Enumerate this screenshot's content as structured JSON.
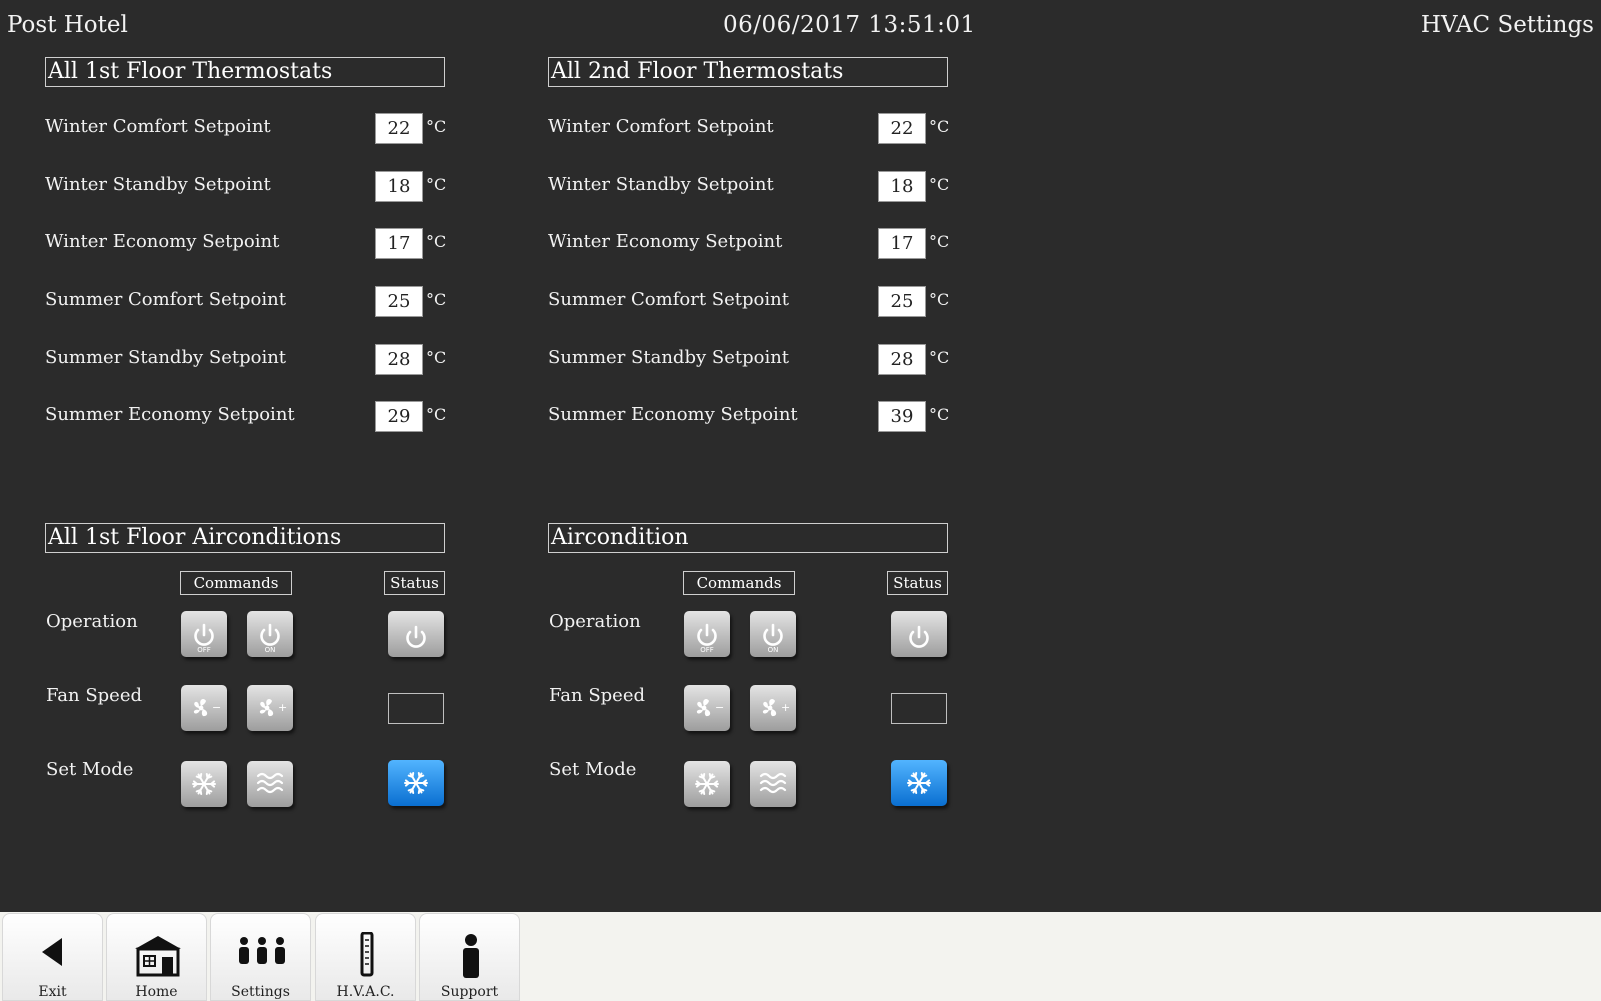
{
  "header": {
    "title": "Post Hotel",
    "datetime": "06/06/2017 13:51:01",
    "page": "HVAC Settings"
  },
  "thermostats": [
    {
      "title": "All 1st Floor Thermostats",
      "unit": "°C",
      "rows": [
        {
          "label": "Winter Comfort Setpoint",
          "value": "22"
        },
        {
          "label": "Winter Standby Setpoint",
          "value": "18"
        },
        {
          "label": "Winter Economy Setpoint",
          "value": "17"
        },
        {
          "label": "Summer Comfort Setpoint",
          "value": "25"
        },
        {
          "label": "Summer Standby Setpoint",
          "value": "28"
        },
        {
          "label": "Summer Economy Setpoint",
          "value": "29"
        }
      ]
    },
    {
      "title": "All 2nd Floor Thermostats",
      "unit": "°C",
      "rows": [
        {
          "label": "Winter Comfort Setpoint",
          "value": "22"
        },
        {
          "label": "Winter Standby Setpoint",
          "value": "18"
        },
        {
          "label": "Winter Economy Setpoint",
          "value": "17"
        },
        {
          "label": "Summer Comfort Setpoint",
          "value": "25"
        },
        {
          "label": "Summer Standby Setpoint",
          "value": "28"
        },
        {
          "label": "Summer Economy Setpoint",
          "value": "39"
        }
      ]
    }
  ],
  "airconditions": [
    {
      "title": "All 1st Floor Airconditions",
      "commands_label": "Commands",
      "status_label": "Status",
      "rows": {
        "operation": "Operation",
        "fan_speed": "Fan Speed",
        "set_mode": "Set Mode"
      },
      "icons": {
        "power_off": "power-off-icon",
        "power_on": "power-on-icon",
        "fan_down": "fan-speed-down-icon",
        "fan_up": "fan-speed-up-icon",
        "cool": "snowflake-icon",
        "heat": "heat-waves-icon"
      },
      "button_text": {
        "off": "OFF",
        "on": "ON"
      },
      "status": {
        "operation": "power-icon",
        "fan_speed": "",
        "mode": "cool"
      }
    },
    {
      "title": "Aircondition",
      "commands_label": "Commands",
      "status_label": "Status",
      "rows": {
        "operation": "Operation",
        "fan_speed": "Fan Speed",
        "set_mode": "Set Mode"
      },
      "icons": {
        "power_off": "power-off-icon",
        "power_on": "power-on-icon",
        "fan_down": "fan-speed-down-icon",
        "fan_up": "fan-speed-up-icon",
        "cool": "snowflake-icon",
        "heat": "heat-waves-icon"
      },
      "button_text": {
        "off": "OFF",
        "on": "ON"
      },
      "status": {
        "operation": "power-icon",
        "fan_speed": "",
        "mode": "cool"
      }
    }
  ],
  "colors": {
    "background": "#2b2b2b",
    "active_mode": "#1a86e8",
    "footer": "#f3f3ef"
  },
  "nav": [
    {
      "label": "Exit",
      "icon": "back-arrow-icon"
    },
    {
      "label": "Home",
      "icon": "home-icon"
    },
    {
      "label": "Settings",
      "icon": "people-icon"
    },
    {
      "label": "H.V.A.C.",
      "icon": "thermometer-icon"
    },
    {
      "label": "Support",
      "icon": "person-icon"
    }
  ]
}
